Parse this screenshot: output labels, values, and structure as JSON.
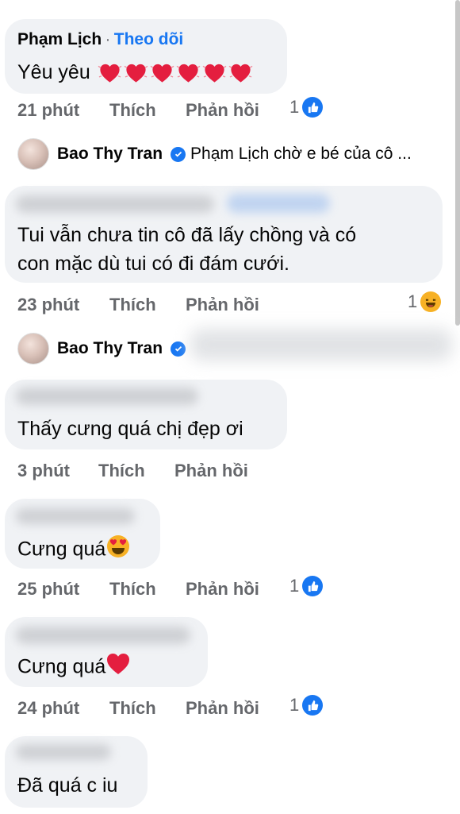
{
  "comments": [
    {
      "author": "Phạm Lịch",
      "separator": "·",
      "follow": "Theo dõi",
      "text": "Yêu yêu",
      "hearts": 6,
      "time": "21 phút",
      "like": "Thích",
      "reply": "Phản hồi",
      "reaction_count": "1",
      "reaction": "like-icon"
    },
    {
      "text_line1": "Tui vẫn chưa tin cô đã lấy chồng và có",
      "text_line2": "con mặc dù tui có đi đám cưới.",
      "time": "23 phút",
      "like": "Thích",
      "reply": "Phản hồi",
      "reaction_count": "1",
      "reaction": "haha-icon"
    },
    {
      "text": "Thấy cưng quá chị đẹp ơi",
      "time": "3 phút",
      "like": "Thích",
      "reply": "Phản hồi"
    },
    {
      "text": "Cưng quá",
      "emoji": "heart-eyes-icon",
      "time": "25 phút",
      "like": "Thích",
      "reply": "Phản hồi",
      "reaction_count": "1",
      "reaction": "like-icon"
    },
    {
      "text": "Cưng quá",
      "emoji": "red-heart-icon",
      "time": "24 phút",
      "like": "Thích",
      "reply": "Phản hồi",
      "reaction_count": "1",
      "reaction": "like-icon"
    },
    {
      "text": "Đã quá c iu"
    }
  ],
  "replies": [
    {
      "name": "Bao Thy Tran",
      "text": "Phạm Lịch chờ e bé của cô ..."
    },
    {
      "name": "Bao Thy Tran"
    }
  ],
  "colors": {
    "accent": "#1877f2",
    "bubble": "#f0f2f5",
    "meta": "#65676b",
    "heart": "#e41e3f"
  }
}
